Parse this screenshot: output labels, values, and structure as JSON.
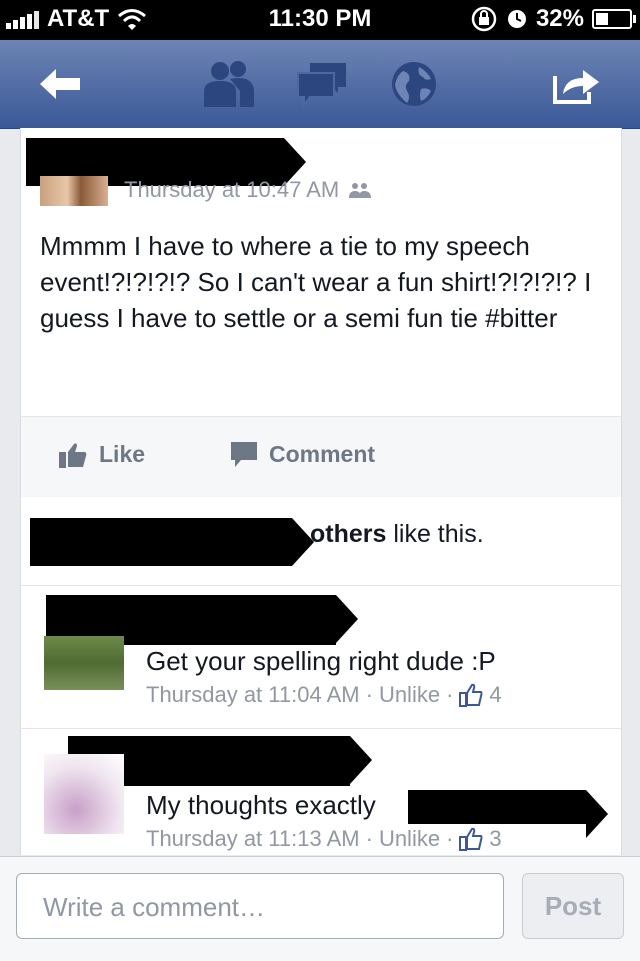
{
  "status_bar": {
    "carrier": "AT&T",
    "time": "11:30 PM",
    "battery": "32%",
    "battery_level": 0.32
  },
  "nav": {
    "icons": [
      "back-arrow-icon",
      "friend-requests-icon",
      "messages-icon",
      "notifications-globe-icon",
      "share-icon"
    ]
  },
  "post": {
    "timestamp": "Thursday at 10:47 AM",
    "privacy_icon": "friends-icon",
    "text": "Mmmm I have to where a tie to my speech event!?!?!?!? So I can't wear a fun shirt!?!?!?!? I guess I have to settle or a semi fun tie #bitter"
  },
  "actions": {
    "like_label": "Like",
    "comment_label": "Comment"
  },
  "likes_summary": {
    "others": "others",
    "suffix": " like this."
  },
  "comments": [
    {
      "text": "Get your spelling right dude :P",
      "timestamp": "Thursday at 11:04 AM",
      "unlike_label": "Unlike",
      "like_count": "4"
    },
    {
      "text": "My thoughts exactly",
      "timestamp": "Thursday at 11:13 AM",
      "unlike_label": "Unlike",
      "like_count": "3"
    }
  ],
  "composer": {
    "placeholder": "Write a comment…",
    "post_label": "Post"
  },
  "colors": {
    "nav_blue": "#3b5998",
    "link_blue": "#3b5998",
    "meta_gray": "#9197a3"
  }
}
